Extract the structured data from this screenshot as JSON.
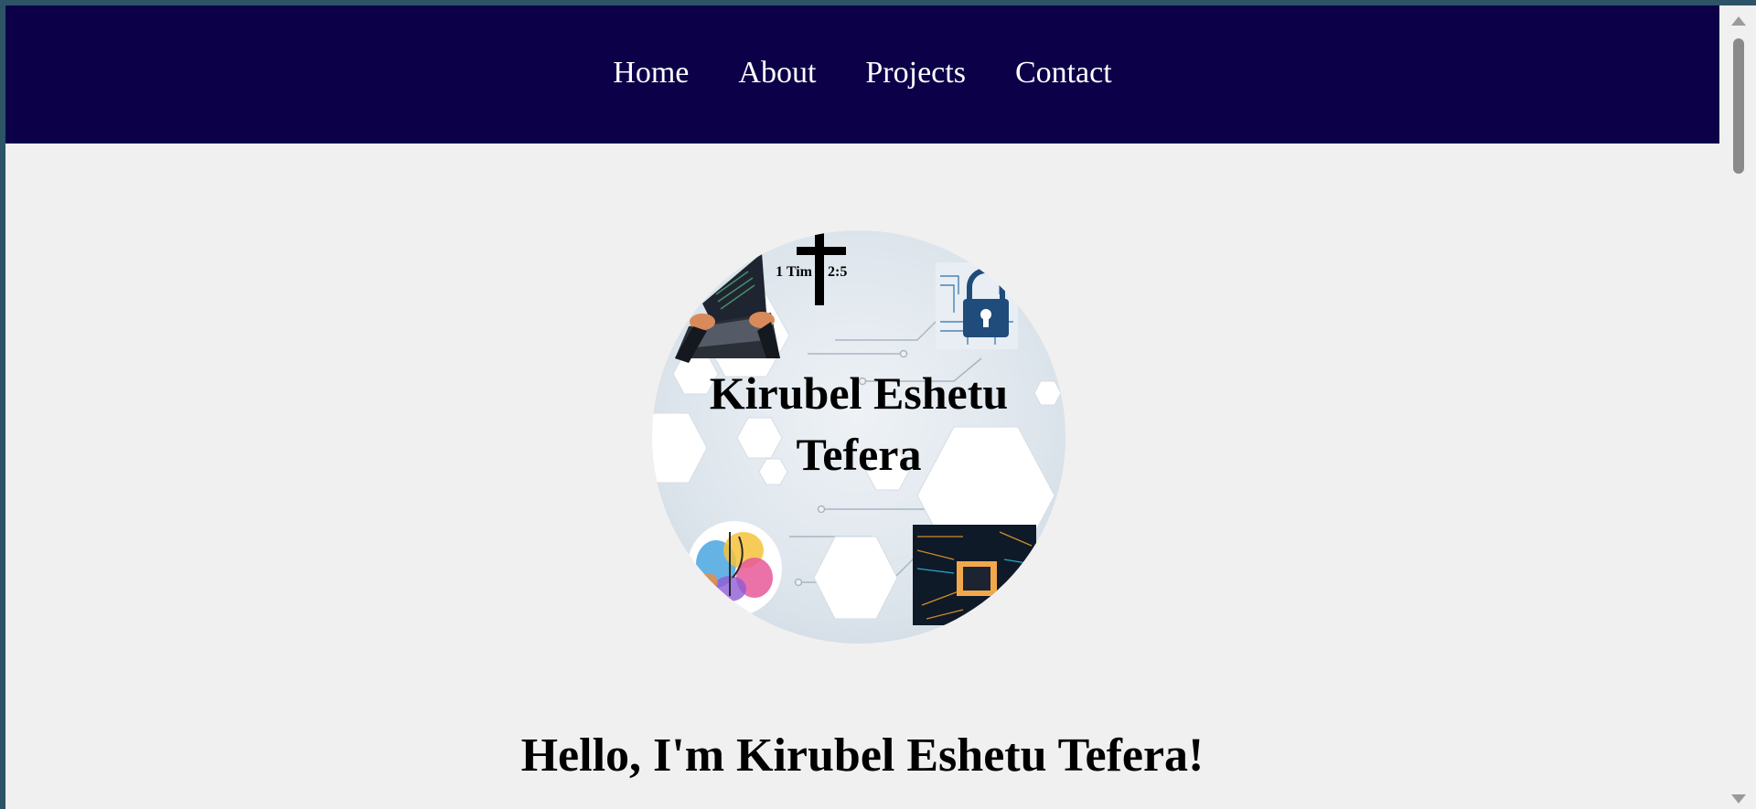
{
  "nav": {
    "items": [
      {
        "label": "Home"
      },
      {
        "label": "About"
      },
      {
        "label": "Projects"
      },
      {
        "label": "Contact"
      }
    ]
  },
  "profile": {
    "name_line1": "Kirubel Eshetu",
    "name_line2": "Tefera",
    "verse": "1 Tim 2:5",
    "verse_left": "1 Tim",
    "verse_right": "2:5"
  },
  "hero": {
    "heading": "Hello, I'm Kirubel Eshetu Tefera!"
  },
  "colors": {
    "navbar": "#0c0048",
    "page_bg": "#f0f0f0",
    "text": "#000000",
    "nav_text": "#ffffff"
  }
}
